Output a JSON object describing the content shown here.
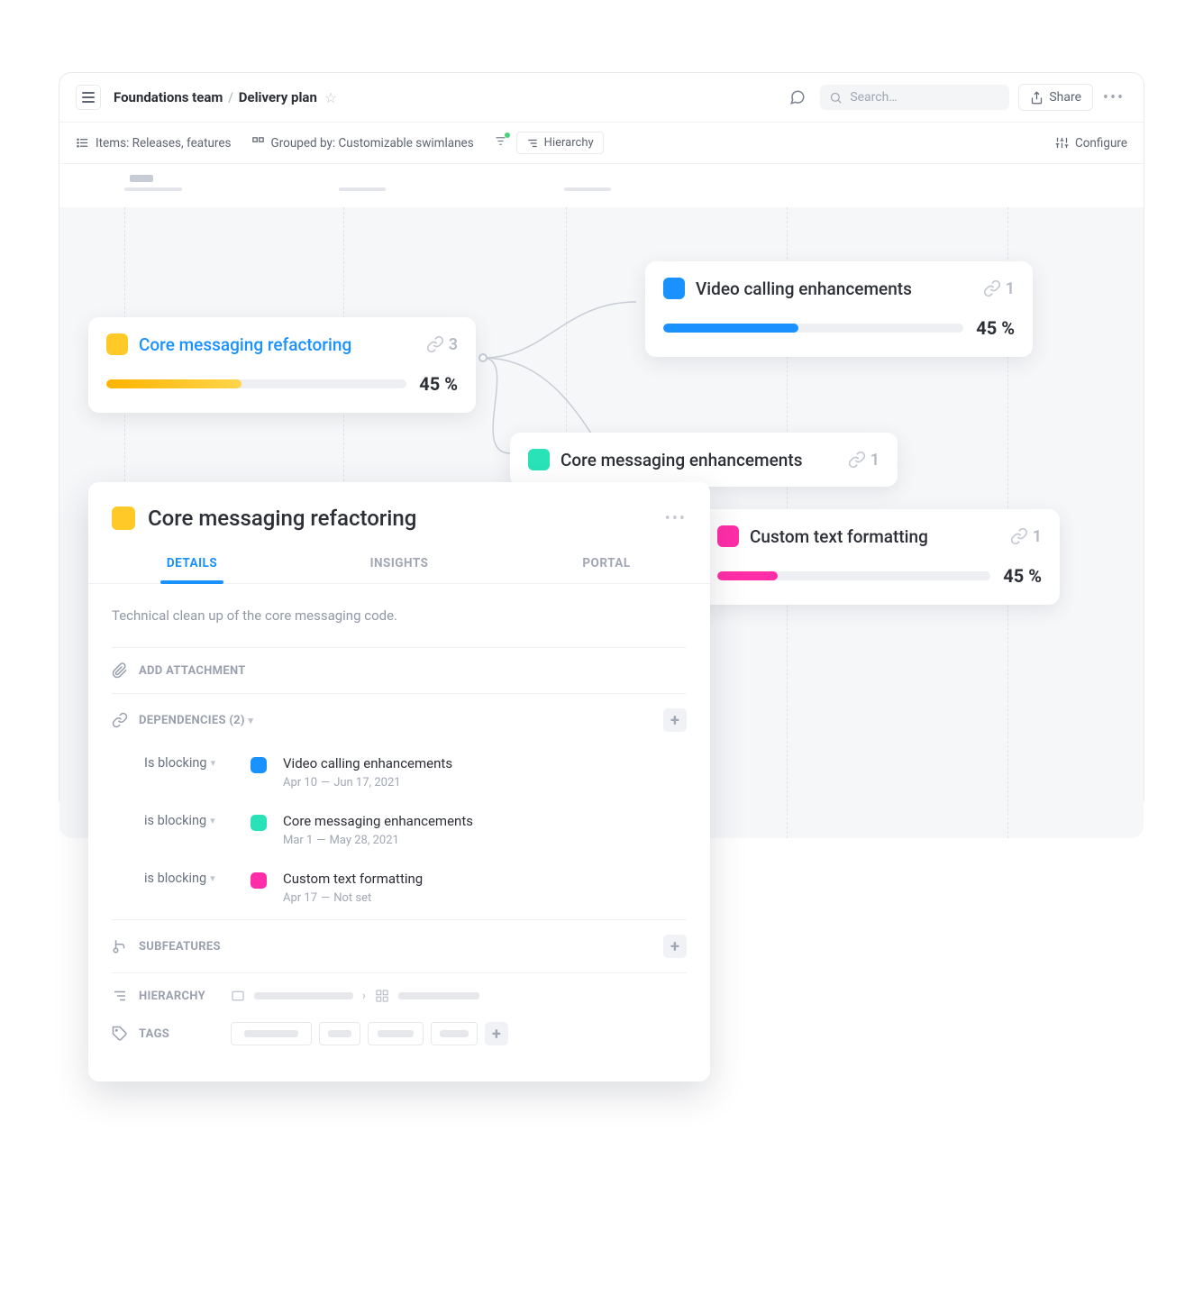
{
  "header": {
    "breadcrumb_team": "Foundations team",
    "breadcrumb_page": "Delivery plan",
    "search_placeholder": "Search…",
    "share_label": "Share"
  },
  "toolbar": {
    "items_label": "Items: Releases, features",
    "grouped_label": "Grouped by: Customizable swimlanes",
    "hierarchy_label": "Hierarchy",
    "configure_label": "Configure"
  },
  "cards": {
    "main": {
      "title": "Core messaging refactoring",
      "color": "#ffc928",
      "title_color": "#1991ff",
      "links": "3",
      "progress": 45,
      "progress_label": "45 %",
      "progress_color": "#ffc928"
    },
    "c1": {
      "title": "Video calling enhancements",
      "color": "#1991ff",
      "links": "1",
      "progress": 45,
      "progress_label": "45 %",
      "progress_color": "#1991ff"
    },
    "c2": {
      "title": "Core messaging enhancements",
      "color": "#29e2b8",
      "links": "1"
    },
    "c3": {
      "title": "Custom text formatting",
      "color": "#ff2ea8",
      "links": "1",
      "progress": 45,
      "progress_label": "45 %",
      "progress_color": "#ff2ea8"
    }
  },
  "panel": {
    "title": "Core messaging refactoring",
    "color": "#ffc928",
    "tabs": {
      "details": "DETAILS",
      "insights": "INSIGHTS",
      "portal": "PORTAL"
    },
    "description": "Technical clean up of the core messaging code.",
    "add_attachment": "ADD ATTACHMENT",
    "dependencies_label": "DEPENDENCIES (2)",
    "subfeatures_label": "SUBFEATURES",
    "hierarchy_label": "HIERARCHY",
    "tags_label": "TAGS",
    "deps": [
      {
        "type": "Is blocking",
        "color": "#1991ff",
        "title": "Video calling enhancements",
        "start": "Apr 10",
        "end": "Jun 17, 2021"
      },
      {
        "type": "is blocking",
        "color": "#29e2b8",
        "title": "Core messaging enhancements",
        "start": "Mar 1",
        "end": "May 28, 2021"
      },
      {
        "type": "is blocking",
        "color": "#ff2ea8",
        "title": "Custom text formatting",
        "start": "Apr 17",
        "end": "Not set"
      }
    ]
  }
}
